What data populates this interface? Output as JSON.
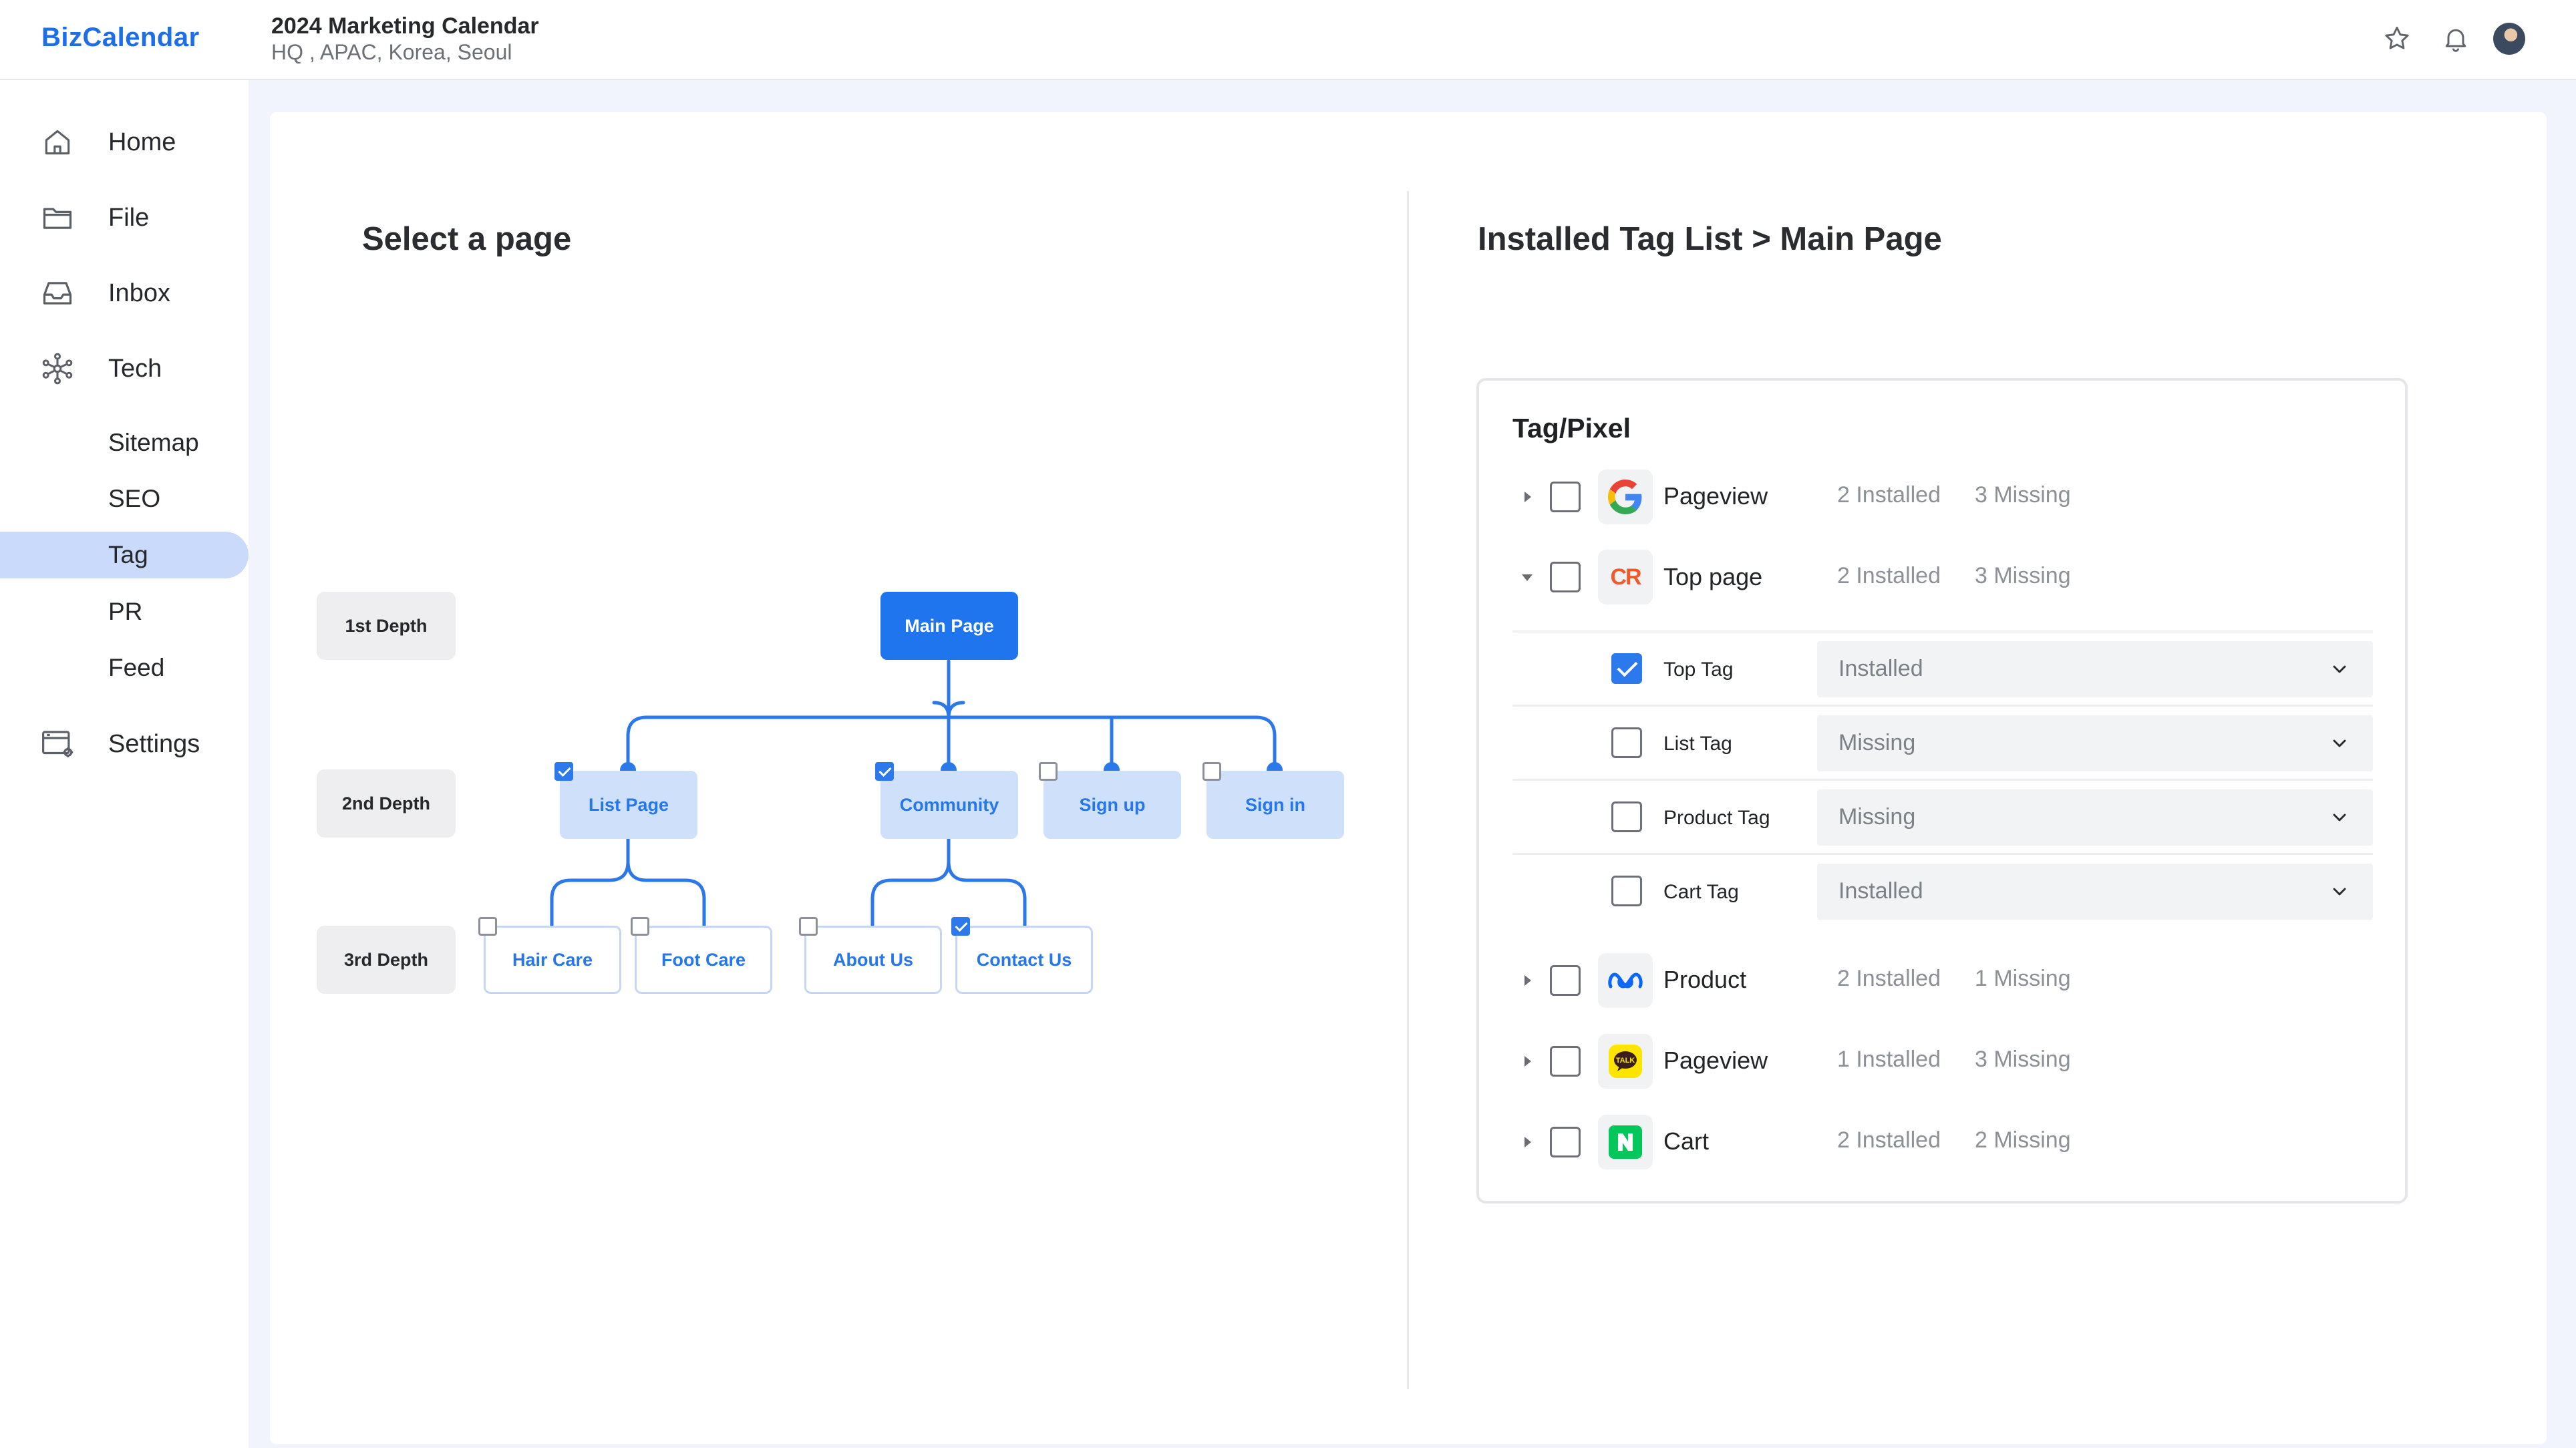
{
  "app": {
    "name": "BizCalendar",
    "title": "2024 Marketing Calendar",
    "subtitle": "HQ , APAC, Korea, Seoul"
  },
  "header": {
    "icons": [
      "star-icon",
      "bell-icon",
      "avatar"
    ]
  },
  "sidebar": {
    "items": [
      {
        "label": "Home",
        "icon": "home-icon"
      },
      {
        "label": "File",
        "icon": "folder-icon"
      },
      {
        "label": "Inbox",
        "icon": "inbox-icon"
      },
      {
        "label": "Tech",
        "icon": "network-icon"
      }
    ],
    "sub_items": [
      {
        "label": "Sitemap"
      },
      {
        "label": "SEO"
      },
      {
        "label": "Tag",
        "active": true
      },
      {
        "label": "PR"
      },
      {
        "label": "Feed"
      }
    ],
    "settings": {
      "label": "Settings",
      "icon": "settings-icon"
    }
  },
  "left": {
    "title": "Select a page",
    "depths": [
      "1st Depth",
      "2nd Depth",
      "3rd Depth"
    ],
    "tree": {
      "root": {
        "label": "Main Page"
      },
      "level2": [
        {
          "label": "List Page",
          "checked": true
        },
        {
          "label": "Community",
          "checked": true
        },
        {
          "label": "Sign up",
          "checked": false
        },
        {
          "label": "Sign in",
          "checked": false
        }
      ],
      "level3": [
        {
          "label": "Hair Care",
          "checked": false
        },
        {
          "label": "Foot Care",
          "checked": false
        },
        {
          "label": "About Us",
          "checked": false
        },
        {
          "label": "Contact Us",
          "checked": true
        }
      ]
    }
  },
  "right": {
    "title": "Installed Tag List > Main Page",
    "panel_title": "Tag/Pixel",
    "rows": [
      {
        "name": "Pageview",
        "installed": "2 Installed",
        "missing": "3 Missing",
        "brand": "google-icon",
        "expanded": false
      },
      {
        "name": "Top page",
        "installed": "2 Installed",
        "missing": "3 Missing",
        "brand": "criteo-icon",
        "expanded": true
      },
      {
        "name": "Product",
        "installed": "2 Installed",
        "missing": "1 Missing",
        "brand": "meta-icon",
        "expanded": false
      },
      {
        "name": "Pageview",
        "installed": "1 Installed",
        "missing": "3 Missing",
        "brand": "kakao-icon",
        "expanded": false
      },
      {
        "name": "Cart",
        "installed": "2 Installed",
        "missing": "2 Missing",
        "brand": "naver-icon",
        "expanded": false
      }
    ],
    "sub_rows": [
      {
        "name": "Top Tag",
        "status": "Installed",
        "checked": true
      },
      {
        "name": "List Tag",
        "status": "Missing",
        "checked": false
      },
      {
        "name": "Product Tag",
        "status": "Missing",
        "checked": false
      },
      {
        "name": "Cart Tag",
        "status": "Installed",
        "checked": false
      }
    ]
  },
  "colors": {
    "brand_blue": "#1c6fe6",
    "accent": "#1f75ee",
    "light_node": "#cfe0fb",
    "sidebar_active": "#c9dafb",
    "page_bg": "#f1f4fd"
  }
}
